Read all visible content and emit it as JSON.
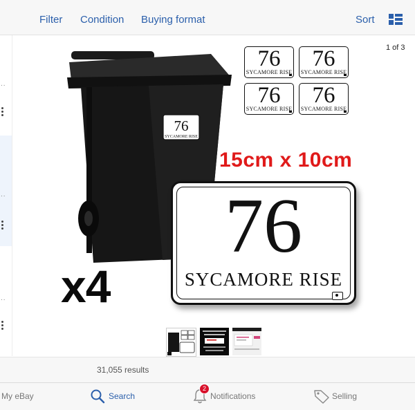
{
  "toolbar": {
    "filter_label": "Filter",
    "condition_label": "Condition",
    "buying_format_label": "Buying format",
    "sort_label": "Sort"
  },
  "viewer": {
    "page_counter": "1 of 3"
  },
  "product_image": {
    "mini_number": "76",
    "mini_street": "SYCAMORE RISE",
    "bin_number": "76",
    "bin_street": "SYCAMORE RISE",
    "size_text": "15cm x 10cm",
    "big_number": "76",
    "big_street": "SYCAMORE RISE",
    "quantity_text": "x4"
  },
  "results": {
    "count_text": "31,055 results"
  },
  "tabbar": {
    "my_ebay": "My eBay",
    "search": "Search",
    "notifications": "Notifications",
    "notifications_badge": "2",
    "selling": "Selling"
  },
  "colors": {
    "accent": "#2b5fab",
    "size_text": "#e01a1a",
    "badge": "#d8102a"
  }
}
